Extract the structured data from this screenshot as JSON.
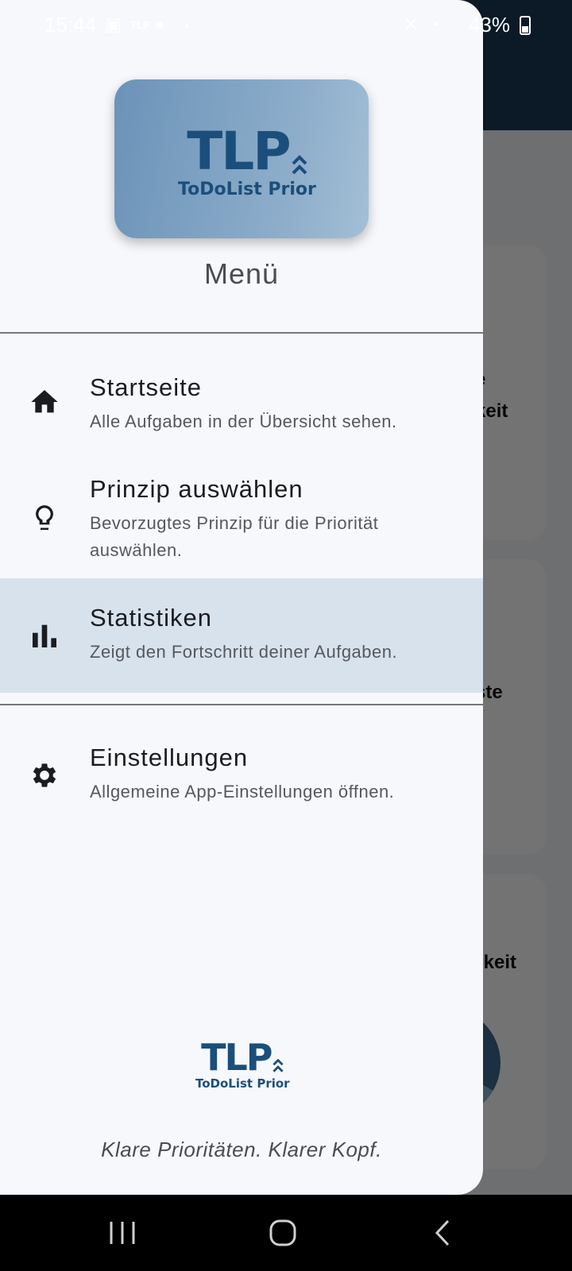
{
  "status_bar": {
    "time": "15:44",
    "battery": "43%"
  },
  "drawer": {
    "logo_main": "TLP",
    "logo_sub": "ToDoList Prior",
    "title": "Menü",
    "items": [
      {
        "title": "Startseite",
        "subtitle": "Alle Aufgaben in der Übersicht sehen.",
        "icon": "home-icon",
        "active": false
      },
      {
        "title": "Prinzip auswählen",
        "subtitle": "Bevorzugtes Prinzip für die Priorität auswählen.",
        "icon": "lightbulb-icon",
        "active": false
      },
      {
        "title": "Statistiken",
        "subtitle": "Zeigt den Fortschritt deiner Aufgaben.",
        "icon": "bar-chart-icon",
        "active": true
      },
      {
        "title": "Einstellungen",
        "subtitle": "Allgemeine App-Einstellungen öffnen.",
        "icon": "settings-gear-icon",
        "active": false
      }
    ],
    "slogan": "Klare Prioritäten. Klarer Kopf."
  },
  "background": {
    "fragment_1": "e",
    "fragment_2": "keit",
    "fragment_3": "ste",
    "fragment_4": "gkeit"
  },
  "colors": {
    "accent": "#1b4e7b",
    "drawer_bg": "#f6f8fc",
    "active_item_bg": "#d8e2ec",
    "appbar": "#1b3a57"
  }
}
